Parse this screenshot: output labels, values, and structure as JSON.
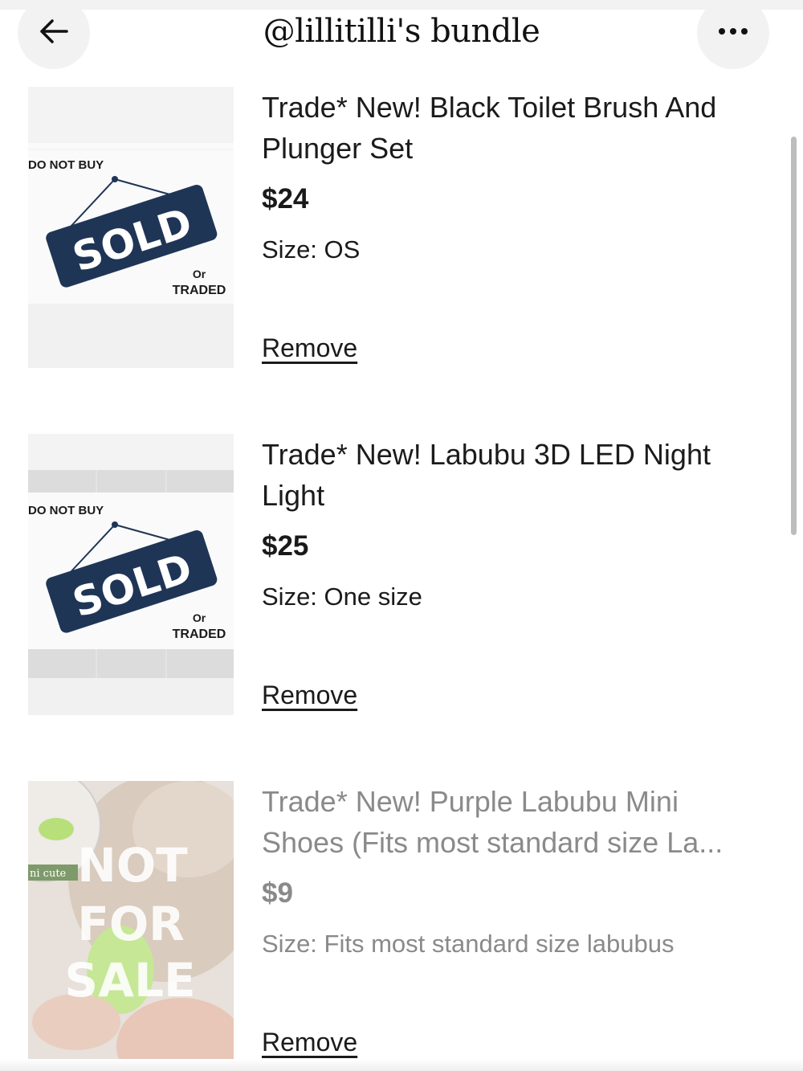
{
  "header": {
    "title": "@lillitilli's bundle",
    "back_icon": "arrow-left-icon",
    "more_icon": "ellipsis-icon"
  },
  "items": [
    {
      "title_line1": "Trade* New! Black Toilet Brush And",
      "title_line2": "Plunger Set",
      "price": "$24",
      "size": "Size: OS",
      "remove_label": "Remove",
      "thumb": {
        "top_text": "DO NOT BUY",
        "sign_text": "SOLD",
        "or_text": "Or",
        "traded_text": "TRADED"
      }
    },
    {
      "title_line1": "Trade* New! Labubu 3D LED Night",
      "title_line2": "Light",
      "price": "$25",
      "size": "Size: One size",
      "remove_label": "Remove",
      "thumb": {
        "top_text": "DO NOT BUY",
        "sign_text": "SOLD",
        "or_text": "Or",
        "traded_text": "TRADED"
      }
    },
    {
      "title_line1": "Trade* New! Purple Labubu Mini",
      "title_line2": "Shoes (Fits most standard size La...",
      "price": "$9",
      "size": "Size: Fits most standard size labubus",
      "remove_label": "Remove",
      "thumb": {
        "tag_text": "ni cute",
        "overlay_line1": "NOT",
        "overlay_line2": "FOR",
        "overlay_line3": "SALE"
      }
    }
  ],
  "colors": {
    "sign_navy": "#1f3556",
    "text_dark": "#1b1b1b",
    "text_muted": "#8a8a8a",
    "button_bg": "#f2f2f2"
  }
}
